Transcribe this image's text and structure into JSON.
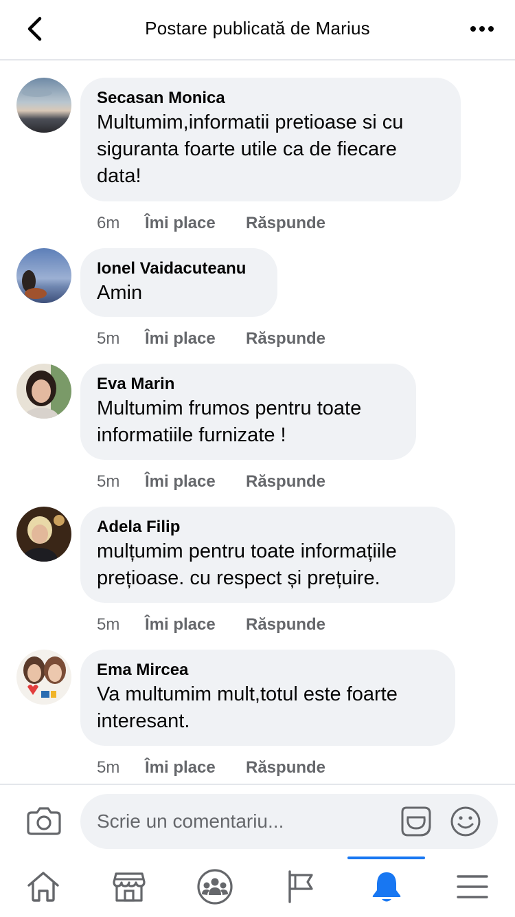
{
  "header": {
    "title": "Postare publicată de Marius",
    "back_icon": "chevron-left-icon",
    "more_icon": "more-horizontal-icon"
  },
  "actions": {
    "like_label": "Îmi place",
    "reply_label": "Răspunde"
  },
  "comments": [
    {
      "author": "Secasan Monica",
      "lines": [
        "Multumim,informatii pretioase si cu",
        "siguranta foarte utile ca de fiecare",
        "data!"
      ],
      "time": "6m"
    },
    {
      "author": "Ionel Vaidacuteanu",
      "lines": [
        "Amin"
      ],
      "time": "5m"
    },
    {
      "author": "Eva Marin",
      "lines": [
        "Multumim frumos pentru toate",
        "informatiile furnizate !"
      ],
      "time": "5m"
    },
    {
      "author": "Adela Filip",
      "lines": [
        "mulțumim pentru toate informațiile",
        "prețioase. cu respect și prețuire."
      ],
      "time": "5m"
    },
    {
      "author": "Ema Mircea",
      "lines": [
        "Va multumim mult,totul este foarte",
        "interesant."
      ],
      "time": "5m"
    }
  ],
  "composer": {
    "placeholder": "Scrie un comentariu...",
    "camera_icon": "camera-icon",
    "gif_icon": "gif-sticker-icon",
    "emoji_icon": "emoji-icon"
  },
  "tabbar": {
    "tabs": [
      {
        "icon": "home-icon",
        "active": false
      },
      {
        "icon": "marketplace-icon",
        "active": false
      },
      {
        "icon": "groups-icon",
        "active": false
      },
      {
        "icon": "pages-flag-icon",
        "active": false
      },
      {
        "icon": "bell-icon",
        "active": true
      },
      {
        "icon": "menu-icon",
        "active": false
      }
    ]
  },
  "colors": {
    "accent": "#1877f2",
    "bubble": "#f0f2f5",
    "secondary_text": "#65676b",
    "divider": "#e4e6eb"
  }
}
